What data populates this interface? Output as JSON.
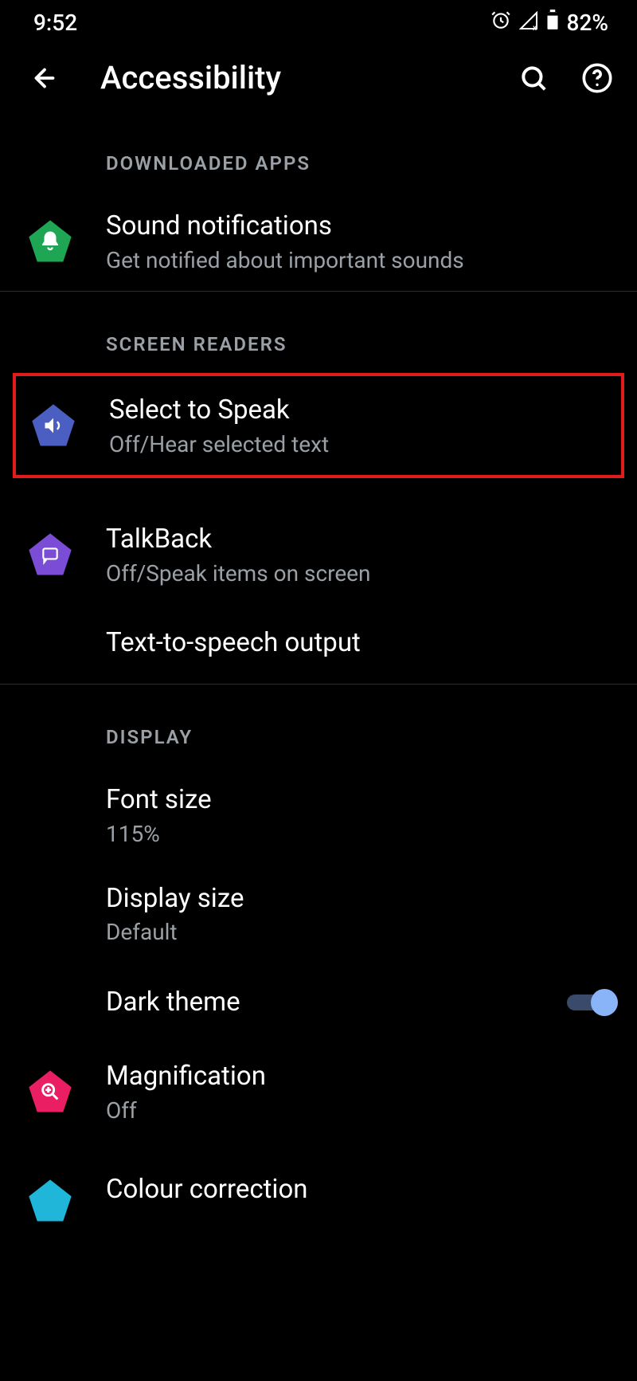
{
  "status": {
    "time": "9:52",
    "battery": "82%"
  },
  "appbar": {
    "title": "Accessibility"
  },
  "sections": {
    "downloaded": {
      "header": "Downloaded apps"
    },
    "readers": {
      "header": "Screen readers"
    },
    "display": {
      "header": "Display"
    }
  },
  "items": {
    "sound_notifications": {
      "title": "Sound notifications",
      "sub": "Get notified about important sounds"
    },
    "select_to_speak": {
      "title": "Select to Speak",
      "sub": "Off/Hear selected text"
    },
    "talkback": {
      "title": "TalkBack",
      "sub": "Off/Speak items on screen"
    },
    "tts": {
      "title": "Text-to-speech output"
    },
    "font_size": {
      "title": "Font size",
      "sub": "115%"
    },
    "display_size": {
      "title": "Display size",
      "sub": "Default"
    },
    "dark_theme": {
      "title": "Dark theme"
    },
    "magnification": {
      "title": "Magnification",
      "sub": "Off"
    },
    "colour_correction": {
      "title": "Colour correction"
    }
  },
  "colors": {
    "green": "#1ea654",
    "blue": "#4a5fc1",
    "purple": "#7b4dd6",
    "pink": "#e91e63",
    "cyan": "#1fb6d9"
  }
}
